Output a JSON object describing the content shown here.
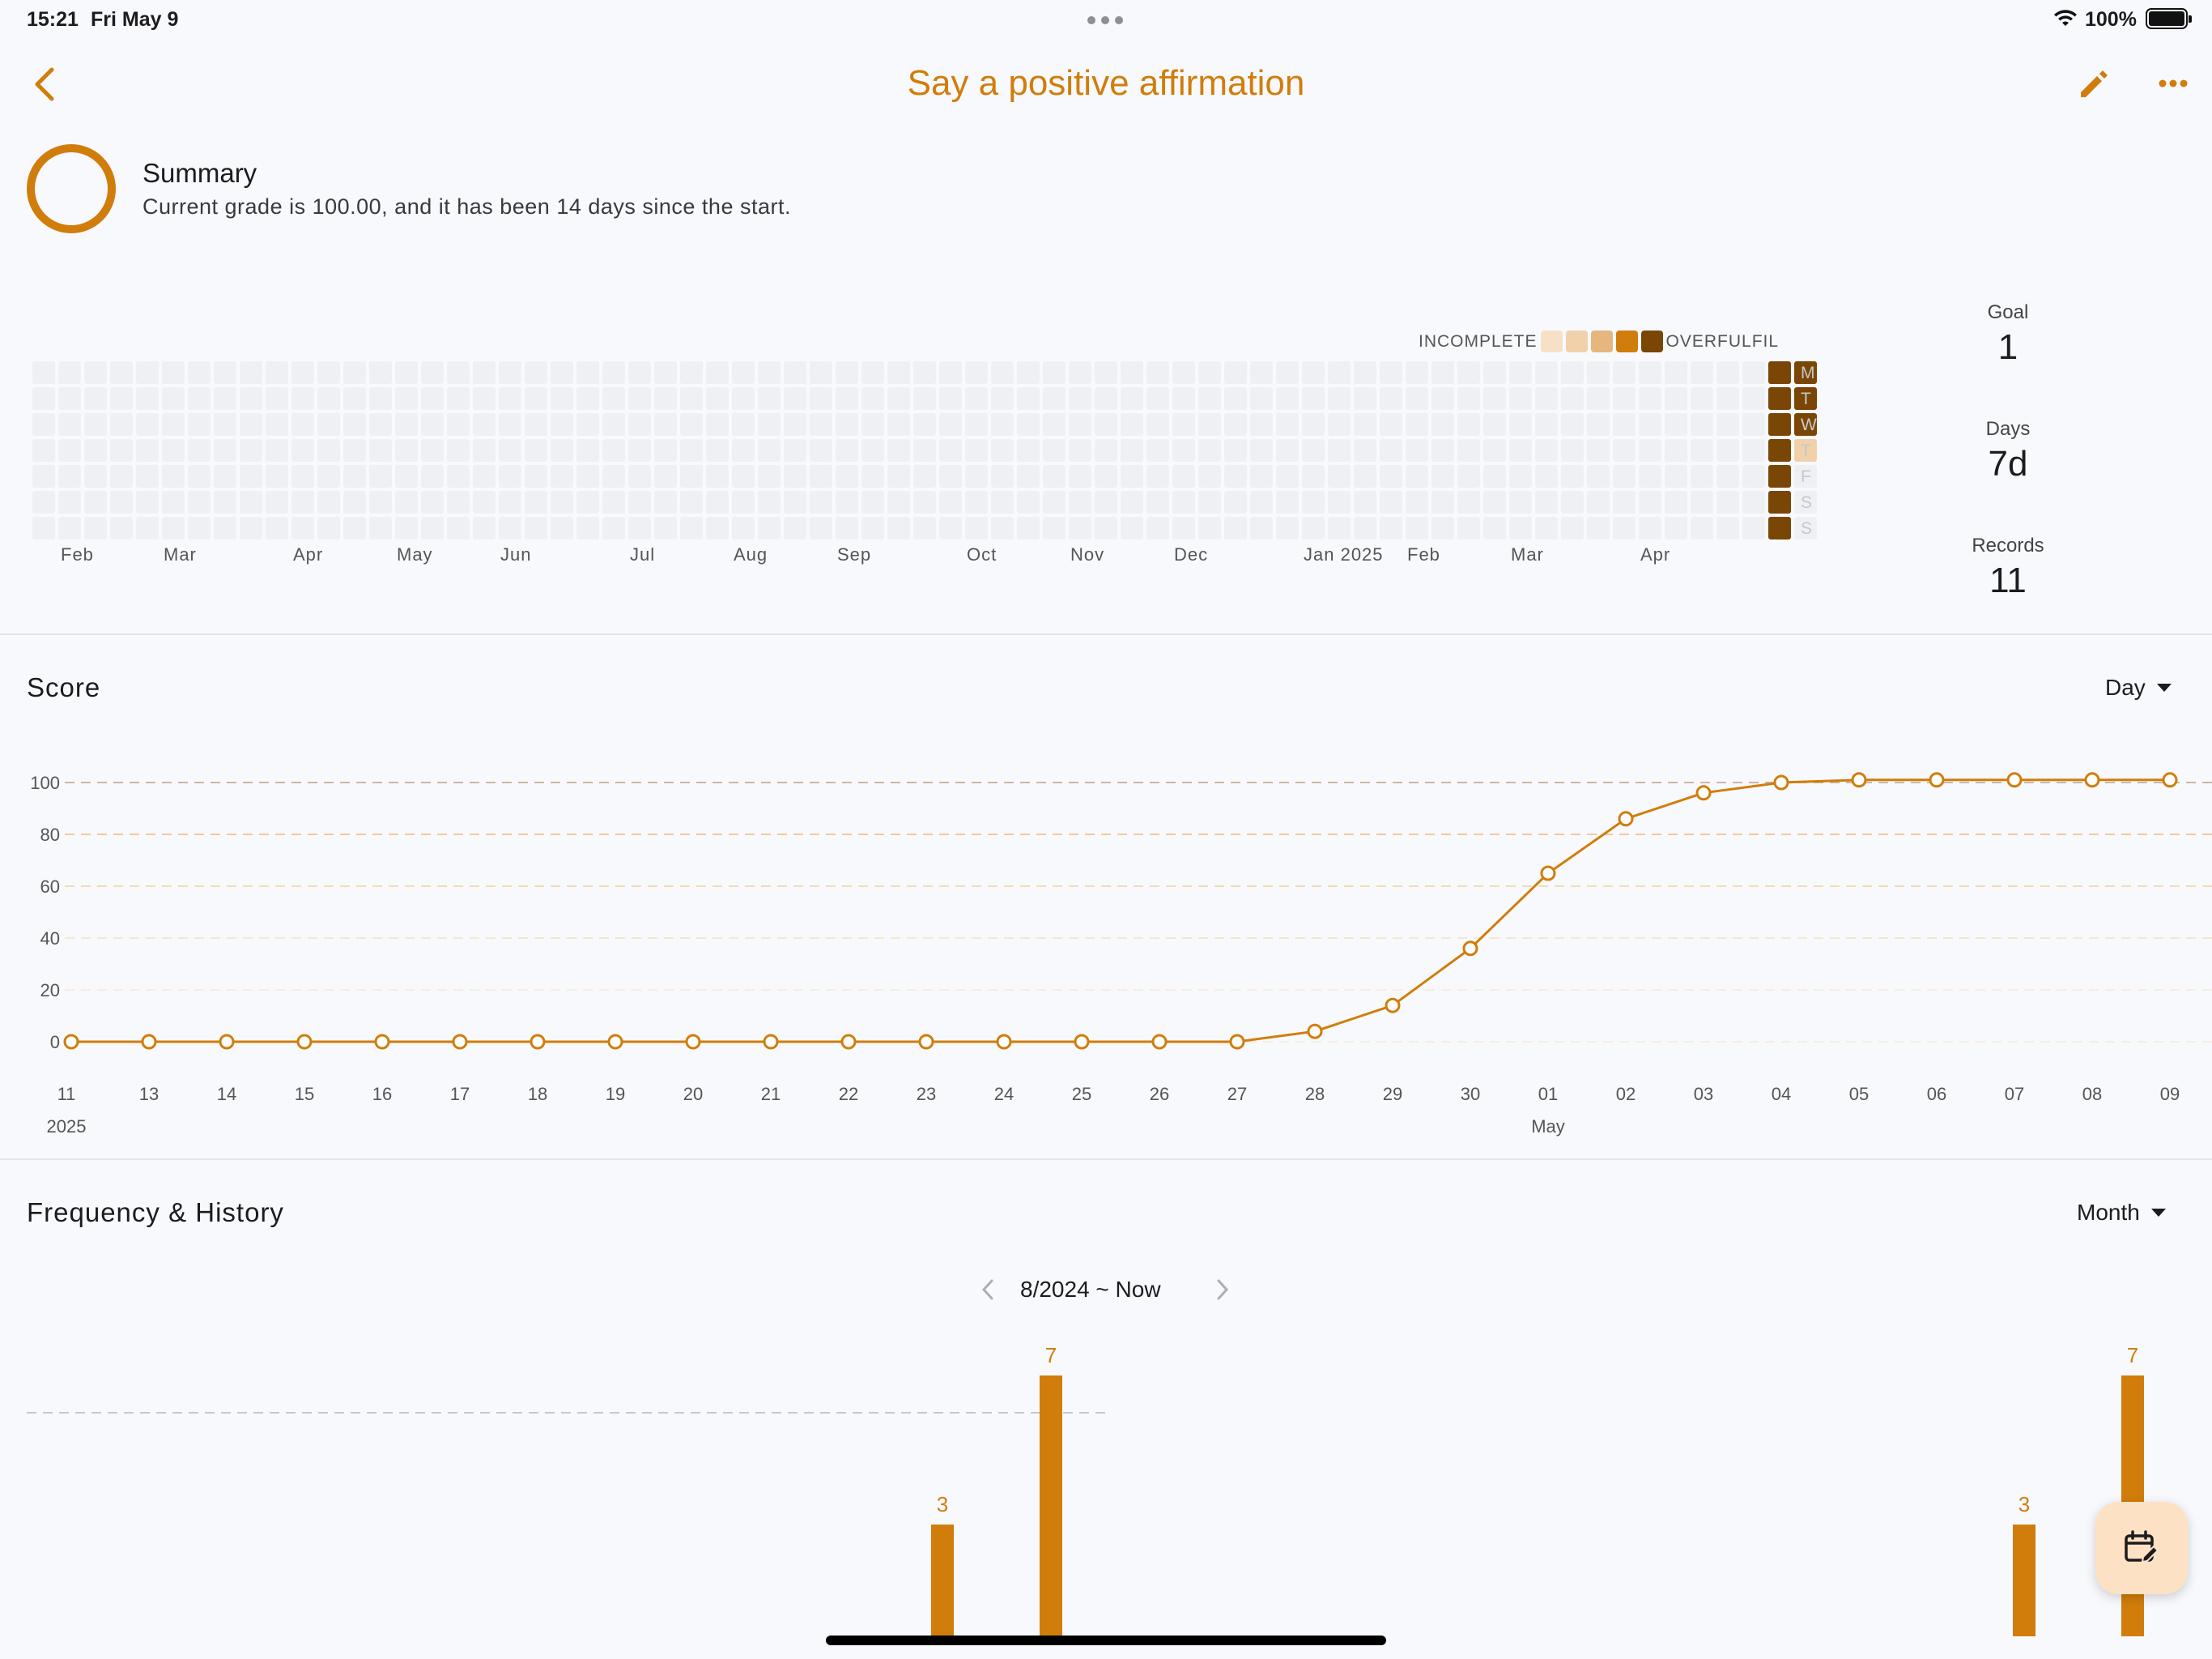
{
  "status_bar": {
    "time": "15:21",
    "date": "Fri May 9",
    "battery": "100%"
  },
  "header": {
    "title": "Say a positive affirmation",
    "back_icon": "chevron-left-icon",
    "edit_icon": "pencil-icon",
    "more_icon": "more-icon"
  },
  "summary": {
    "title": "Summary",
    "text": "Current grade is 100.00, and it has been 14 days since the start."
  },
  "heatmap": {
    "legend_left": "INCOMPLETE",
    "legend_right": "OVERFULFIL",
    "legend_colors": [
      "#f6e1c7",
      "#f1d1aa",
      "#e6b67f",
      "#d17d0b",
      "#7a4605"
    ],
    "months": [
      "Feb",
      "Mar",
      "Apr",
      "May",
      "Jun",
      "Jul",
      "Aug",
      "Sep",
      "Oct",
      "Nov",
      "Dec",
      "Jan 2025",
      "Feb",
      "Mar",
      "Apr"
    ],
    "days_of_week": [
      "M",
      "T",
      "W",
      "T",
      "F",
      "S",
      "S"
    ],
    "week_columns": 69,
    "filled_cells": [
      {
        "week": 67,
        "day": 0,
        "level": 4
      },
      {
        "week": 67,
        "day": 1,
        "level": 4
      },
      {
        "week": 67,
        "day": 2,
        "level": 4
      },
      {
        "week": 67,
        "day": 3,
        "level": 4
      },
      {
        "week": 67,
        "day": 4,
        "level": 4
      },
      {
        "week": 67,
        "day": 5,
        "level": 4
      },
      {
        "week": 67,
        "day": 6,
        "level": 4
      },
      {
        "week": 68,
        "day": 0,
        "level": 4
      },
      {
        "week": 68,
        "day": 1,
        "level": 4
      },
      {
        "week": 68,
        "day": 2,
        "level": 4
      },
      {
        "week": 68,
        "day": 3,
        "level": 1
      }
    ],
    "empty_color": "#eef0f4"
  },
  "stats": {
    "goal_label": "Goal",
    "goal_value": "1",
    "days_label": "Days",
    "days_value": "7d",
    "records_label": "Records",
    "records_value": "11"
  },
  "score": {
    "title": "Score",
    "period": "Day",
    "chart_data": {
      "type": "line",
      "x": [
        "11",
        "13",
        "14",
        "15",
        "16",
        "17",
        "18",
        "19",
        "20",
        "21",
        "22",
        "23",
        "24",
        "25",
        "26",
        "27",
        "28",
        "29",
        "30",
        "01",
        "02",
        "03",
        "04",
        "05",
        "06",
        "07",
        "08",
        "09"
      ],
      "x_sublabels": [
        {
          "index": 0,
          "text": "2025"
        },
        {
          "index": 19,
          "text": "May"
        }
      ],
      "values": [
        0,
        0,
        0,
        0,
        0,
        0,
        0,
        0,
        0,
        0,
        0,
        0,
        0,
        0,
        0,
        0,
        4,
        14,
        36,
        65,
        86,
        96,
        100,
        101,
        101,
        101,
        101,
        101
      ],
      "yticks": [
        100,
        80,
        60,
        40,
        20,
        0
      ],
      "ylim": [
        0,
        100
      ],
      "color": "#d17d0b"
    }
  },
  "frequency": {
    "title": "Frequency & History",
    "period": "Month",
    "range": "8/2024 ~ Now",
    "chart_data": {
      "type": "bar",
      "bars": [
        {
          "value": 3,
          "label": "3"
        },
        {
          "value": 7,
          "label": "7"
        },
        {
          "value": 3,
          "label": "3"
        },
        {
          "value": 7,
          "label": "7"
        }
      ],
      "color": "#d17d0b"
    }
  },
  "fab_icon": "calendar-edit-icon"
}
